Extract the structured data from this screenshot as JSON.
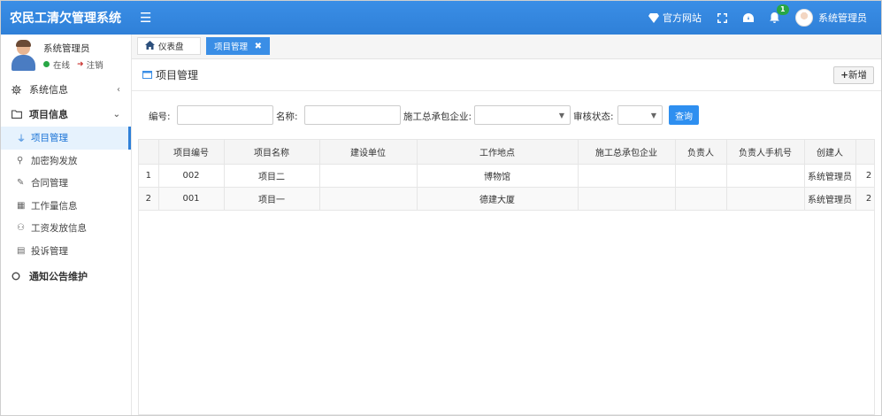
{
  "app": {
    "title": "农民工清欠管理系统"
  },
  "topbar": {
    "official_site": "官方网站",
    "notification_count": "1",
    "user_name": "系统管理员"
  },
  "sidebar": {
    "user": {
      "name": "系统管理员",
      "status": "在线",
      "logout": "注销"
    },
    "groups": [
      {
        "label": "系统信息"
      },
      {
        "label": "项目信息"
      },
      {
        "label": "通知公告维护"
      }
    ],
    "items": [
      {
        "label": "项目管理"
      },
      {
        "label": "加密狗发放"
      },
      {
        "label": "合同管理"
      },
      {
        "label": "工作量信息"
      },
      {
        "label": "工资发放信息"
      },
      {
        "label": "投诉管理"
      }
    ]
  },
  "tabs": [
    {
      "label": "仪表盘"
    },
    {
      "label": "项目管理",
      "close": "✖"
    }
  ],
  "panel": {
    "title": "项目管理",
    "add_label": "新增"
  },
  "search": {
    "code_label": "编号:",
    "name_label": "名称:",
    "contractor_label": "施工总承包企业:",
    "status_label": "审核状态:",
    "query_label": "查询"
  },
  "table": {
    "columns": [
      "",
      "项目编号",
      "项目名称",
      "建设单位",
      "工作地点",
      "施工总承包企业",
      "负责人",
      "负责人手机号",
      "创建人",
      ""
    ],
    "rows": [
      [
        "1",
        "002",
        "项目二",
        "",
        "博物馆",
        "",
        "",
        "",
        "系统管理员",
        "2"
      ],
      [
        "2",
        "001",
        "项目一",
        "",
        "德建大厦",
        "",
        "",
        "",
        "系统管理员",
        "2"
      ]
    ]
  },
  "colors": {
    "primary": "#2f80d8",
    "active_bg": "#e6f2fd",
    "online": "#28a745"
  }
}
